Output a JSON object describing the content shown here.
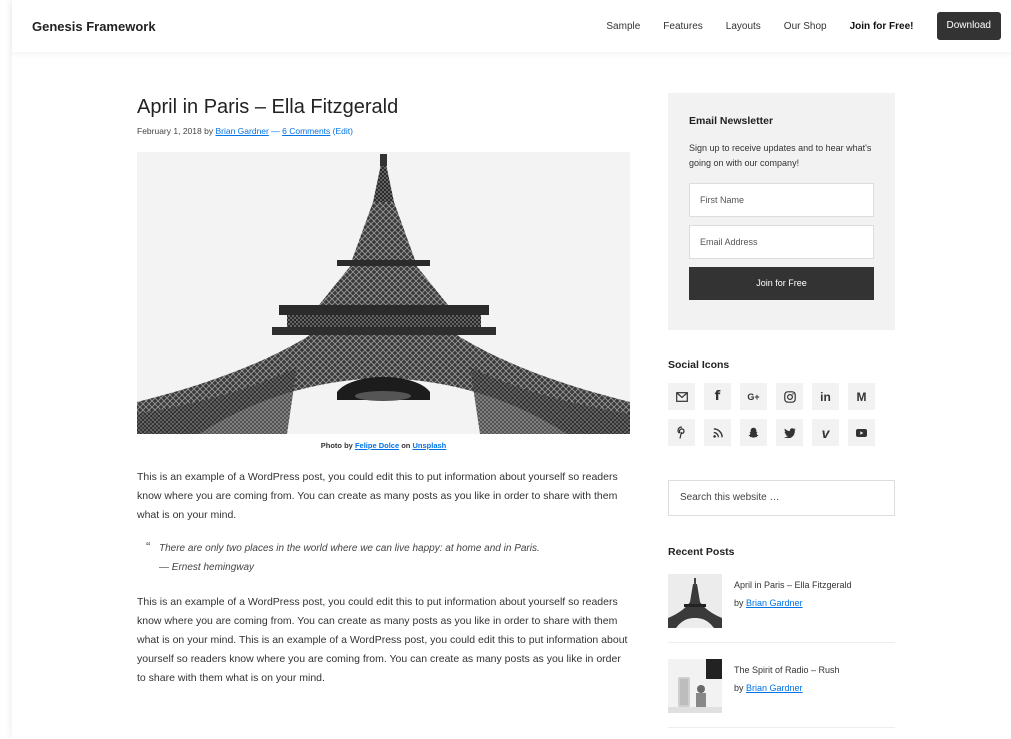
{
  "header": {
    "site_title": "Genesis Framework",
    "nav": [
      {
        "label": "Sample"
      },
      {
        "label": "Features"
      },
      {
        "label": "Layouts"
      },
      {
        "label": "Our Shop"
      },
      {
        "label": "Join for Free!"
      }
    ],
    "download_label": "Download"
  },
  "post": {
    "title": "April in Paris – Ella Fitzgerald",
    "date": "February 1, 2018",
    "by": "by",
    "author": "Brian Gardner",
    "dash": "—",
    "comments": "6 Comments",
    "edit": "(Edit)",
    "caption_prefix": "Photo by",
    "caption_author": "Felipe Dolce",
    "caption_on": "on",
    "caption_site": "Unsplash",
    "paragraph1": "This is an example of a WordPress post, you could edit this to put information about yourself so readers know where you are coming from. You can create as many posts as you like in order to share with them what is on your mind.",
    "quote_mark": "“",
    "quote_line1": "There are only two places in the world where we can live happy: at home and in Paris.",
    "quote_line2": "— Ernest hemingway",
    "paragraph2": "This is an example of a WordPress post, you could edit this to put information about yourself so readers know where you are coming from. You can create as many posts as you like in order to share with them what is on your mind. This is an example of a WordPress post, you could edit this to put information about yourself so readers know where you are coming from. You can create as many posts as you like in order to share with them what is on your mind."
  },
  "sidebar": {
    "newsletter": {
      "title": "Email Newsletter",
      "text": "Sign up to receive updates and to hear what's going on with our company!",
      "first_name_placeholder": "First Name",
      "email_placeholder": "Email Address",
      "button": "Join for Free"
    },
    "social": {
      "title": "Social Icons",
      "icons": [
        "mail-icon",
        "facebook-icon",
        "google-plus-icon",
        "instagram-icon",
        "linkedin-icon",
        "medium-icon",
        "pinterest-icon",
        "rss-icon",
        "snapchat-icon",
        "twitter-icon",
        "vimeo-icon",
        "youtube-icon"
      ],
      "glyphs": {
        "facebook": "f",
        "google": "G+",
        "linkedin": "in",
        "medium": "M",
        "vimeo": "v"
      }
    },
    "search_placeholder": "Search this website …",
    "recent": {
      "title": "Recent Posts",
      "by": "by",
      "items": [
        {
          "title": "April in Paris – Ella Fitzgerald",
          "author": "Brian Gardner"
        },
        {
          "title": "The Spirit of Radio – Rush",
          "author": "Brian Gardner"
        }
      ]
    }
  }
}
